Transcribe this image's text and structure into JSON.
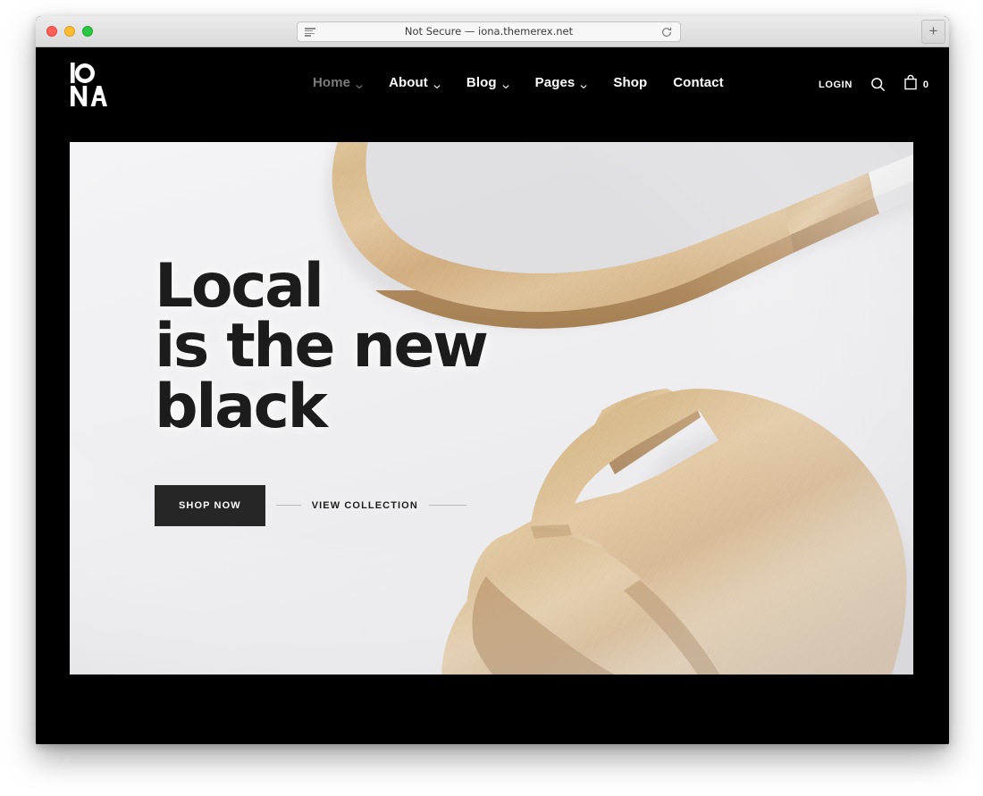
{
  "browser": {
    "url_text": "Not Secure — iona.themerex.net",
    "reader_icon": "reader-icon",
    "reload_icon": "reload-icon",
    "newtab_label": "+",
    "traffic_lights": [
      "close-red",
      "minimize-amber",
      "zoom-green"
    ]
  },
  "site": {
    "logo": {
      "text": "IONA",
      "line1": "IO",
      "line2": "NA"
    },
    "nav": [
      {
        "label": "Home",
        "has_dropdown": true,
        "active": true
      },
      {
        "label": "About",
        "has_dropdown": true,
        "active": false
      },
      {
        "label": "Blog",
        "has_dropdown": true,
        "active": false
      },
      {
        "label": "Pages",
        "has_dropdown": true,
        "active": false
      },
      {
        "label": "Shop",
        "has_dropdown": false,
        "active": false
      },
      {
        "label": "Contact",
        "has_dropdown": false,
        "active": false
      }
    ],
    "header_right": {
      "login_label": "LOGIN",
      "search_icon": "search-icon",
      "cart_icon": "shopping-bag-icon",
      "cart_count": "0"
    },
    "hero": {
      "title_line1": "Local",
      "title_line2": "is the new",
      "title_line3": "black",
      "primary_button": "SHOP NOW",
      "secondary_link": "VIEW COLLECTION",
      "image_subject": "wooden bamboo salad servers on light gray background"
    },
    "colors": {
      "site_background": "#000000",
      "hero_background": "#f0f0f2",
      "text_dark": "#1c1c1c",
      "button_dark": "#262626",
      "nav_active": "#7b7b7b",
      "wood_light": "#e0c49b",
      "wood_mid": "#d2ac7d",
      "wood_dark": "#b58a58"
    }
  }
}
